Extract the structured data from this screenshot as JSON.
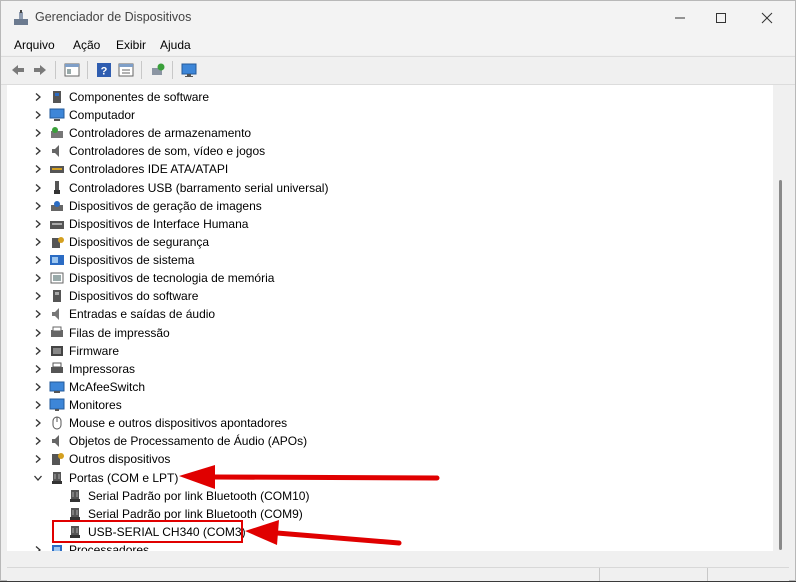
{
  "window": {
    "title": "Gerenciador de Dispositivos",
    "controls": [
      "minimize-icon",
      "maximize-icon",
      "close-icon"
    ]
  },
  "menu": [
    "Arquivo",
    "Ação",
    "Exibir",
    "Ajuda"
  ],
  "toolbar": {
    "icons": [
      "back-arrow-icon",
      "forward-arrow-icon",
      "properties-pane-icon",
      "help-icon",
      "details-pane-icon",
      "scan-hardware-icon",
      "monitor-icon"
    ]
  },
  "tree": [
    {
      "label": "Componentes de software",
      "icon": "software-component-icon",
      "state": "collapsed"
    },
    {
      "label": "Computador",
      "icon": "computer-icon",
      "state": "collapsed"
    },
    {
      "label": "Controladores de armazenamento",
      "icon": "storage-controller-icon",
      "state": "collapsed"
    },
    {
      "label": "Controladores de som, vídeo e jogos",
      "icon": "speaker-icon",
      "state": "collapsed"
    },
    {
      "label": "Controladores IDE ATA/ATAPI",
      "icon": "ide-controller-icon",
      "state": "collapsed"
    },
    {
      "label": "Controladores USB (barramento serial universal)",
      "icon": "usb-icon",
      "state": "collapsed"
    },
    {
      "label": "Dispositivos de geração de imagens",
      "icon": "imaging-device-icon",
      "state": "collapsed"
    },
    {
      "label": "Dispositivos de Interface Humana",
      "icon": "hid-icon",
      "state": "collapsed"
    },
    {
      "label": "Dispositivos de segurança",
      "icon": "security-device-icon",
      "state": "collapsed"
    },
    {
      "label": "Dispositivos de sistema",
      "icon": "system-device-icon",
      "state": "collapsed"
    },
    {
      "label": "Dispositivos de tecnologia de memória",
      "icon": "memory-device-icon",
      "state": "collapsed"
    },
    {
      "label": "Dispositivos do software",
      "icon": "software-device-icon",
      "state": "collapsed"
    },
    {
      "label": "Entradas e saídas de áudio",
      "icon": "audio-io-icon",
      "state": "collapsed"
    },
    {
      "label": "Filas de impressão",
      "icon": "print-queue-icon",
      "state": "collapsed"
    },
    {
      "label": "Firmware",
      "icon": "firmware-icon",
      "state": "collapsed"
    },
    {
      "label": "Impressoras",
      "icon": "printer-icon",
      "state": "collapsed"
    },
    {
      "label": "McAfeeSwitch",
      "icon": "network-switch-icon",
      "state": "collapsed"
    },
    {
      "label": "Monitores",
      "icon": "monitor-icon",
      "state": "collapsed"
    },
    {
      "label": "Mouse e outros dispositivos apontadores",
      "icon": "mouse-icon",
      "state": "collapsed"
    },
    {
      "label": "Objetos de Processamento de Áudio (APOs)",
      "icon": "speaker-icon",
      "state": "collapsed"
    },
    {
      "label": "Outros dispositivos",
      "icon": "unknown-device-icon",
      "state": "collapsed"
    },
    {
      "label": "Portas (COM e LPT)",
      "icon": "port-icon",
      "state": "expanded"
    },
    {
      "label": "Serial Padrão por link Bluetooth (COM10)",
      "icon": "port-icon",
      "state": "child"
    },
    {
      "label": "Serial Padrão por link Bluetooth (COM9)",
      "icon": "port-icon",
      "state": "child"
    },
    {
      "label": "USB-SERIAL CH340 (COM3)",
      "icon": "port-icon",
      "state": "child"
    },
    {
      "label": "Processadores",
      "icon": "processor-icon",
      "state": "collapsed"
    }
  ],
  "colors": {
    "annotation": "#e00000",
    "folder_blue": "#2b6cc4"
  }
}
